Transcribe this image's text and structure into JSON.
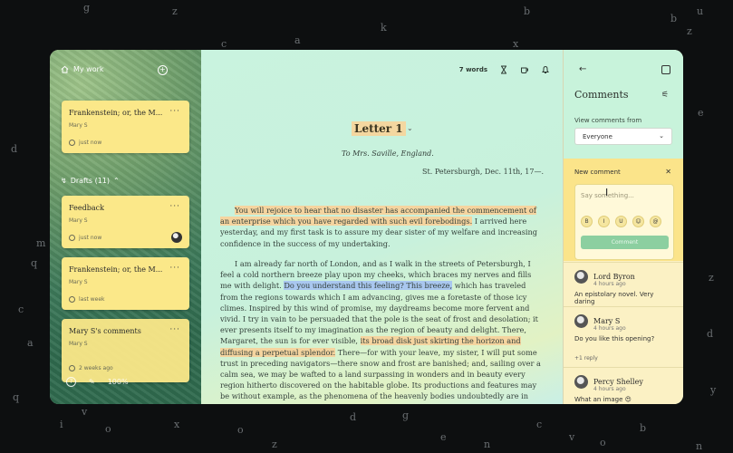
{
  "background_letters": [
    "g",
    "z",
    "a",
    "k",
    "b",
    "z",
    "u",
    "u",
    "b",
    "c",
    "x",
    "d",
    "q",
    "c",
    "m",
    "a",
    "q",
    "o",
    "i",
    "v",
    "x",
    "o",
    "z",
    "d",
    "g",
    "e",
    "c",
    "n",
    "v",
    "o",
    "b",
    "n",
    "e",
    "z",
    "s",
    "a",
    "d",
    "y",
    "e"
  ],
  "sidebar": {
    "header_label": "My work",
    "cards": [
      {
        "title": "Frankenstein; or, the M...",
        "author": "Mary S",
        "time": "just now",
        "has_avatar": false
      },
      {
        "title": "Feedback",
        "author": "Mary S",
        "time": "just now",
        "has_avatar": true
      },
      {
        "title": "Frankenstein; or, the M...",
        "author": "Mary S",
        "time": "last week",
        "has_avatar": false
      },
      {
        "title": "Mary S's comments",
        "author": "Mary S",
        "time": "2 weeks ago",
        "has_avatar": false
      }
    ],
    "drafts_label": "Drafts (11)",
    "zoom": "100%"
  },
  "toolbar": {
    "word_count": "7 words"
  },
  "document": {
    "title": "Letter 1",
    "to": "To Mrs. Saville, England.",
    "place_date": "St. Petersburgh, Dec. 11th, 17—.",
    "p1_hl": "You will rejoice to hear that no disaster has accompanied the commencement of an enterprise which you have regarded with such evil forebodings.",
    "p1_rest": " I arrived here yesterday, and my first task is to assure my dear sister of my welfare and increasing confidence in the success of my undertaking.",
    "p2_a": "I am already far north of London, and as I walk in the streets of Petersburgh, I feel a cold northern breeze play upon my cheeks, which braces my nerves and fills me with delight. ",
    "p2_hl_blue": "Do you understand this feeling? This breeze,",
    "p2_b": " which has traveled from the regions towards which I am advancing, gives me a foretaste of those icy climes. Inspired by this wind of promise, my daydreams become more fervent and vivid. I try in vain to be persuaded that the pole is the seat of frost and desolation; it ever presents itself to my imagination as the region of beauty and delight. There, Margaret, the sun is for ever visible, ",
    "p2_hl_orange": "its broad disk just skirting the horizon and diffusing a perpetual splendor.",
    "p2_c": " There—for with your leave, my sister, I will put some trust in preceding navigators—there snow and frost are banished; and, sailing over a calm sea, we may be wafted to a land surpassing in wonders and in beauty every region hitherto discovered on the habitable globe. Its productions and features may be without example, as the phenomena of the heavenly bodies undoubtedly are in those undiscovered solitudes. What may not be expected in a"
  },
  "comments": {
    "title": "Comments",
    "view_from_label": "View comments from",
    "view_from_value": "Everyone",
    "new_comment_label": "New comment",
    "placeholder": "Say something...",
    "format_buttons": [
      "B",
      "I",
      "U",
      "☺",
      "@"
    ],
    "submit_label": "Comment",
    "items": [
      {
        "name": "Lord Byron",
        "time": "4 hours ago",
        "text": "An epistolary novel. Very daring",
        "reply": ""
      },
      {
        "name": "Mary S",
        "time": "4 hours ago",
        "text": "Do you like this opening?",
        "reply": "+1 reply"
      },
      {
        "name": "Percy Shelley",
        "time": "4 hours ago",
        "text": "What an image 😍",
        "reply": ""
      }
    ]
  }
}
